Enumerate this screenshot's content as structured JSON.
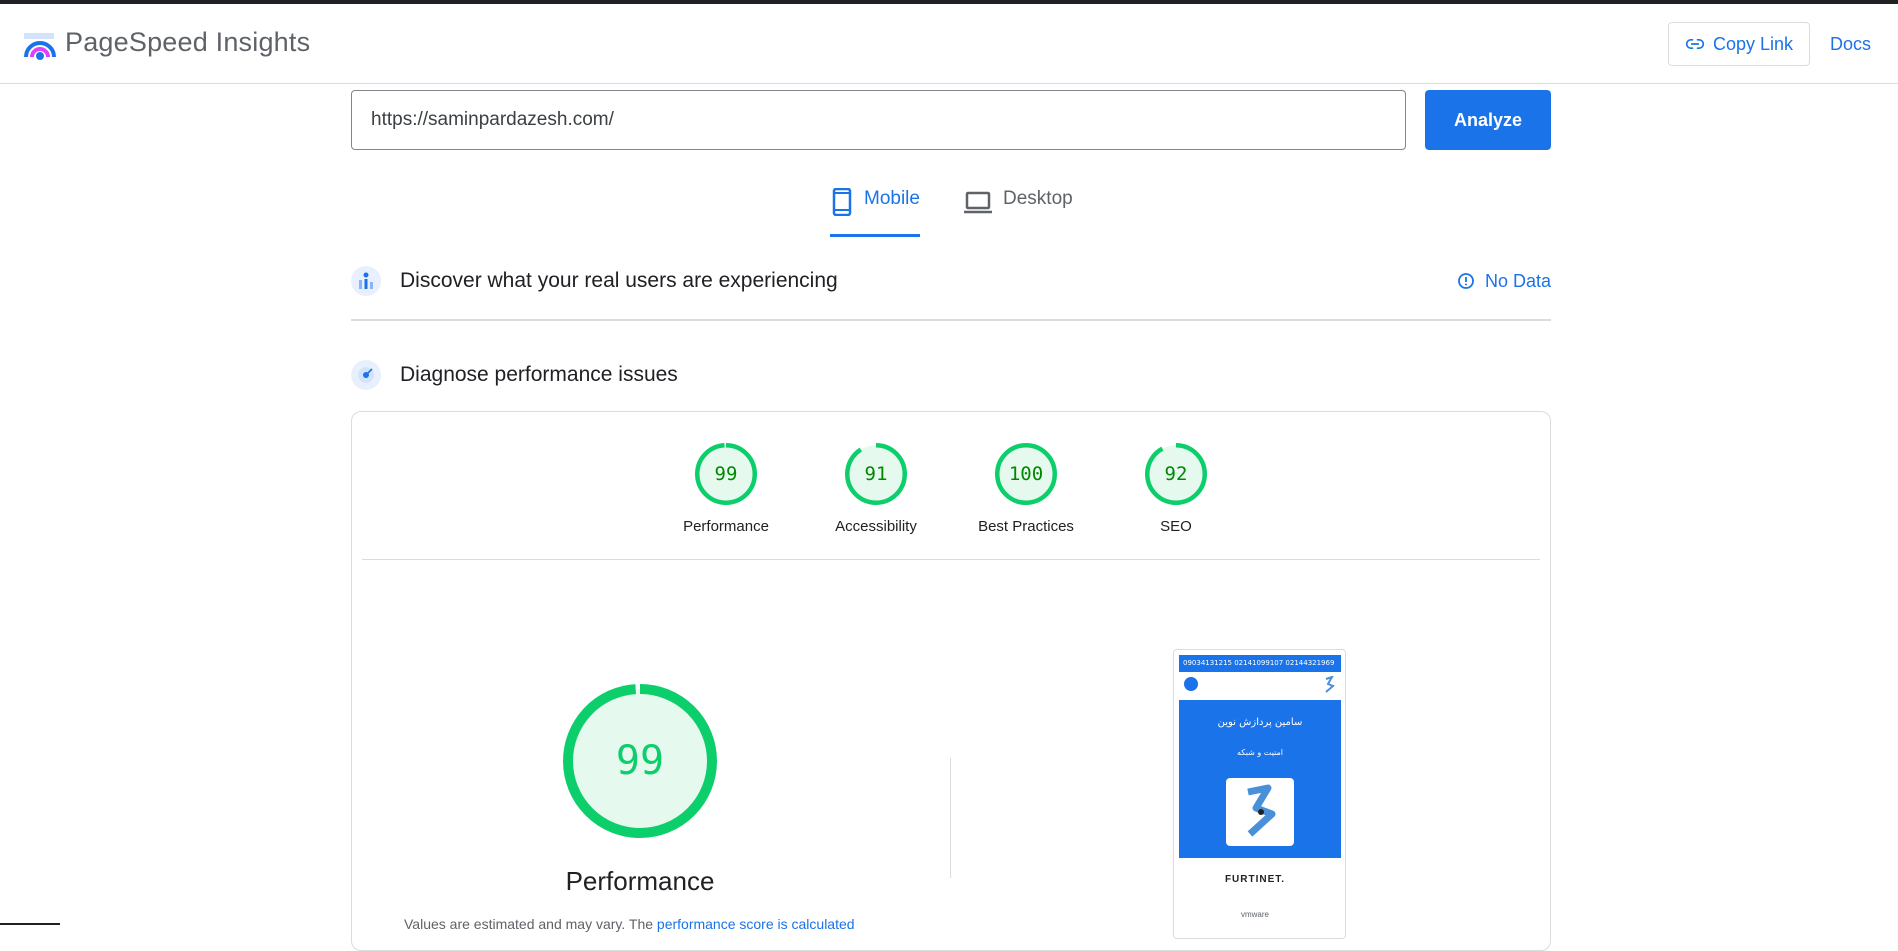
{
  "header": {
    "brand": "PageSpeed Insights",
    "copy_link": "Copy Link",
    "docs": "Docs"
  },
  "search": {
    "url_value": "https://saminpardazesh.com/",
    "analyze_label": "Analyze"
  },
  "tabs": [
    {
      "label": "Mobile",
      "active": true
    },
    {
      "label": "Desktop",
      "active": false
    }
  ],
  "sections": {
    "field_data": {
      "title": "Discover what your real users are experiencing",
      "status": "No Data"
    },
    "lab_data": {
      "title": "Diagnose performance issues"
    }
  },
  "scores": [
    {
      "label": "Performance",
      "value": 99
    },
    {
      "label": "Accessibility",
      "value": 91
    },
    {
      "label": "Best Practices",
      "value": 100
    },
    {
      "label": "SEO",
      "value": 92
    }
  ],
  "performance": {
    "value": 99,
    "label": "Performance",
    "note_prefix": "Values are estimated and may vary. The ",
    "note_link": "performance score is calculated"
  },
  "screenshot": {
    "topbar": "09034131215  02141099107  02144321969",
    "title": "سامین پردازش نوین",
    "subtitle": "امنیت و شبکه",
    "brand1": "FURTINET.",
    "brand2": "vmware"
  },
  "colors": {
    "accent": "#1a73e8",
    "pass_green": "#0cce6b",
    "pass_text": "#008800",
    "pass_fill": "#e6f9ee"
  }
}
